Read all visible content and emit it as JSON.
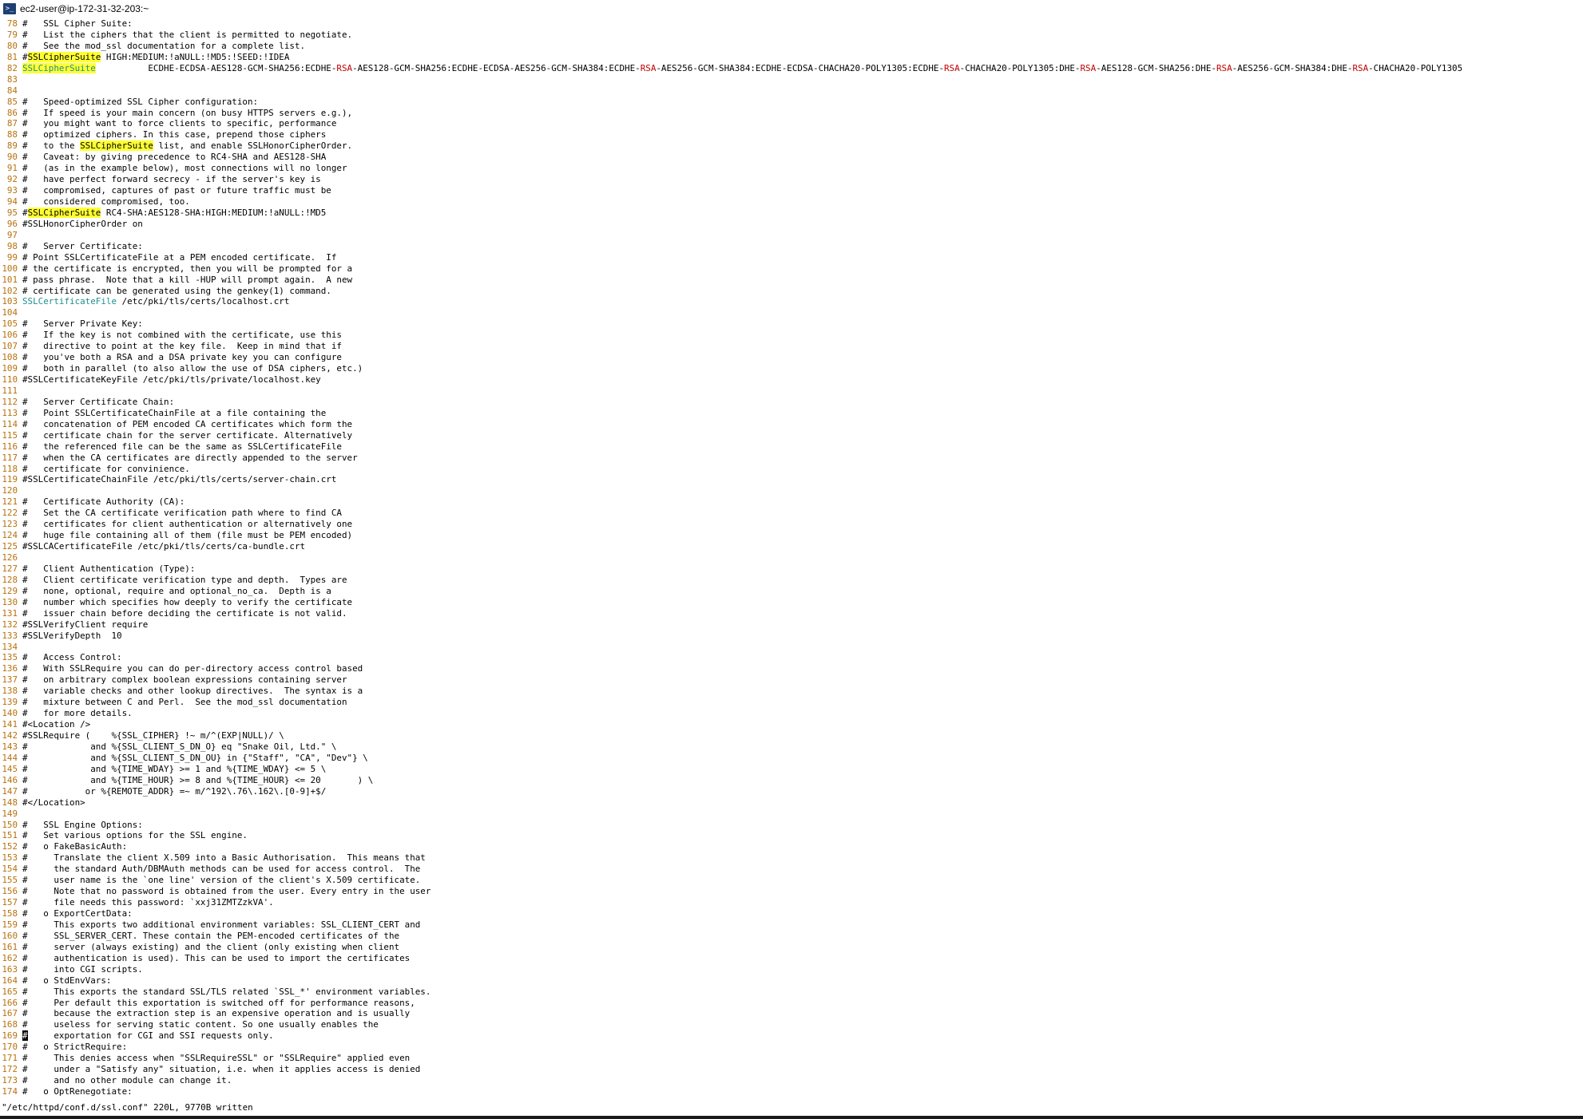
{
  "window": {
    "title": "ec2-user@ip-172-31-32-203:~",
    "icon": "terminal-icon"
  },
  "editor": {
    "lines": [
      {
        "n": "78",
        "t": "#   SSL Cipher Suite:"
      },
      {
        "n": "79",
        "t": "#   List the ciphers that the client is permitted to negotiate."
      },
      {
        "n": "80",
        "t": "#   See the mod_ssl documentation for a complete list."
      },
      {
        "n": "81",
        "t": "#SSLCipherSuite HIGH:MEDIUM:!aNULL:!MD5:!SEED:!IDEA"
      },
      {
        "n": "82",
        "t": "SSLCipherSuite          ECDHE-ECDSA-AES128-GCM-SHA256:ECDHE-RSA-AES128-GCM-SHA256:ECDHE-ECDSA-AES256-GCM-SHA384:ECDHE-RSA-AES256-GCM-SHA384:ECDHE-ECDSA-CHACHA20-POLY1305:ECDHE-RSA-CHACHA20-POLY1305:DHE-RSA-AES128-GCM-SHA256:DHE-RSA-AES256-GCM-SHA384:DHE-RSA-CHACHA20-POLY1305"
      },
      {
        "n": "83",
        "t": ""
      },
      {
        "n": "84",
        "t": ""
      },
      {
        "n": "85",
        "t": "#   Speed-optimized SSL Cipher configuration:"
      },
      {
        "n": "86",
        "t": "#   If speed is your main concern (on busy HTTPS servers e.g.),"
      },
      {
        "n": "87",
        "t": "#   you might want to force clients to specific, performance"
      },
      {
        "n": "88",
        "t": "#   optimized ciphers. In this case, prepend those ciphers"
      },
      {
        "n": "89",
        "t": "#   to the SSLCipherSuite list, and enable SSLHonorCipherOrder."
      },
      {
        "n": "90",
        "t": "#   Caveat: by giving precedence to RC4-SHA and AES128-SHA"
      },
      {
        "n": "91",
        "t": "#   (as in the example below), most connections will no longer"
      },
      {
        "n": "92",
        "t": "#   have perfect forward secrecy - if the server's key is"
      },
      {
        "n": "93",
        "t": "#   compromised, captures of past or future traffic must be"
      },
      {
        "n": "94",
        "t": "#   considered compromised, too."
      },
      {
        "n": "95",
        "t": "#SSLCipherSuite RC4-SHA:AES128-SHA:HIGH:MEDIUM:!aNULL:!MD5"
      },
      {
        "n": "96",
        "t": "#SSLHonorCipherOrder on"
      },
      {
        "n": "97",
        "t": ""
      },
      {
        "n": "98",
        "t": "#   Server Certificate:"
      },
      {
        "n": "99",
        "t": "# Point SSLCertificateFile at a PEM encoded certificate.  If"
      },
      {
        "n": "100",
        "t": "# the certificate is encrypted, then you will be prompted for a"
      },
      {
        "n": "101",
        "t": "# pass phrase.  Note that a kill -HUP will prompt again.  A new"
      },
      {
        "n": "102",
        "t": "# certificate can be generated using the genkey(1) command."
      },
      {
        "n": "103",
        "t": "SSLCertificateFile /etc/pki/tls/certs/localhost.crt"
      },
      {
        "n": "104",
        "t": ""
      },
      {
        "n": "105",
        "t": "#   Server Private Key:"
      },
      {
        "n": "106",
        "t": "#   If the key is not combined with the certificate, use this"
      },
      {
        "n": "107",
        "t": "#   directive to point at the key file.  Keep in mind that if"
      },
      {
        "n": "108",
        "t": "#   you've both a RSA and a DSA private key you can configure"
      },
      {
        "n": "109",
        "t": "#   both in parallel (to also allow the use of DSA ciphers, etc.)"
      },
      {
        "n": "110",
        "t": "#SSLCertificateKeyFile /etc/pki/tls/private/localhost.key"
      },
      {
        "n": "111",
        "t": ""
      },
      {
        "n": "112",
        "t": "#   Server Certificate Chain:"
      },
      {
        "n": "113",
        "t": "#   Point SSLCertificateChainFile at a file containing the"
      },
      {
        "n": "114",
        "t": "#   concatenation of PEM encoded CA certificates which form the"
      },
      {
        "n": "115",
        "t": "#   certificate chain for the server certificate. Alternatively"
      },
      {
        "n": "116",
        "t": "#   the referenced file can be the same as SSLCertificateFile"
      },
      {
        "n": "117",
        "t": "#   when the CA certificates are directly appended to the server"
      },
      {
        "n": "118",
        "t": "#   certificate for convinience."
      },
      {
        "n": "119",
        "t": "#SSLCertificateChainFile /etc/pki/tls/certs/server-chain.crt"
      },
      {
        "n": "120",
        "t": ""
      },
      {
        "n": "121",
        "t": "#   Certificate Authority (CA):"
      },
      {
        "n": "122",
        "t": "#   Set the CA certificate verification path where to find CA"
      },
      {
        "n": "123",
        "t": "#   certificates for client authentication or alternatively one"
      },
      {
        "n": "124",
        "t": "#   huge file containing all of them (file must be PEM encoded)"
      },
      {
        "n": "125",
        "t": "#SSLCACertificateFile /etc/pki/tls/certs/ca-bundle.crt"
      },
      {
        "n": "126",
        "t": ""
      },
      {
        "n": "127",
        "t": "#   Client Authentication (Type):"
      },
      {
        "n": "128",
        "t": "#   Client certificate verification type and depth.  Types are"
      },
      {
        "n": "129",
        "t": "#   none, optional, require and optional_no_ca.  Depth is a"
      },
      {
        "n": "130",
        "t": "#   number which specifies how deeply to verify the certificate"
      },
      {
        "n": "131",
        "t": "#   issuer chain before deciding the certificate is not valid."
      },
      {
        "n": "132",
        "t": "#SSLVerifyClient require"
      },
      {
        "n": "133",
        "t": "#SSLVerifyDepth  10"
      },
      {
        "n": "134",
        "t": ""
      },
      {
        "n": "135",
        "t": "#   Access Control:"
      },
      {
        "n": "136",
        "t": "#   With SSLRequire you can do per-directory access control based"
      },
      {
        "n": "137",
        "t": "#   on arbitrary complex boolean expressions containing server"
      },
      {
        "n": "138",
        "t": "#   variable checks and other lookup directives.  The syntax is a"
      },
      {
        "n": "139",
        "t": "#   mixture between C and Perl.  See the mod_ssl documentation"
      },
      {
        "n": "140",
        "t": "#   for more details."
      },
      {
        "n": "141",
        "t": "#<Location />"
      },
      {
        "n": "142",
        "t": "#SSLRequire (    %{SSL_CIPHER} !~ m/^(EXP|NULL)/ \\"
      },
      {
        "n": "143",
        "t": "#            and %{SSL_CLIENT_S_DN_O} eq \"Snake Oil, Ltd.\" \\"
      },
      {
        "n": "144",
        "t": "#            and %{SSL_CLIENT_S_DN_OU} in {\"Staff\", \"CA\", \"Dev\"} \\"
      },
      {
        "n": "145",
        "t": "#            and %{TIME_WDAY} >= 1 and %{TIME_WDAY} <= 5 \\"
      },
      {
        "n": "146",
        "t": "#            and %{TIME_HOUR} >= 8 and %{TIME_HOUR} <= 20       ) \\"
      },
      {
        "n": "147",
        "t": "#           or %{REMOTE_ADDR} =~ m/^192\\.76\\.162\\.[0-9]+$/"
      },
      {
        "n": "148",
        "t": "#</Location>"
      },
      {
        "n": "149",
        "t": ""
      },
      {
        "n": "150",
        "t": "#   SSL Engine Options:"
      },
      {
        "n": "151",
        "t": "#   Set various options for the SSL engine."
      },
      {
        "n": "152",
        "t": "#   o FakeBasicAuth:"
      },
      {
        "n": "153",
        "t": "#     Translate the client X.509 into a Basic Authorisation.  This means that"
      },
      {
        "n": "154",
        "t": "#     the standard Auth/DBMAuth methods can be used for access control.  The"
      },
      {
        "n": "155",
        "t": "#     user name is the `one line' version of the client's X.509 certificate."
      },
      {
        "n": "156",
        "t": "#     Note that no password is obtained from the user. Every entry in the user"
      },
      {
        "n": "157",
        "t": "#     file needs this password: `xxj31ZMTZzkVA'."
      },
      {
        "n": "158",
        "t": "#   o ExportCertData:"
      },
      {
        "n": "159",
        "t": "#     This exports two additional environment variables: SSL_CLIENT_CERT and"
      },
      {
        "n": "160",
        "t": "#     SSL_SERVER_CERT. These contain the PEM-encoded certificates of the"
      },
      {
        "n": "161",
        "t": "#     server (always existing) and the client (only existing when client"
      },
      {
        "n": "162",
        "t": "#     authentication is used). This can be used to import the certificates"
      },
      {
        "n": "163",
        "t": "#     into CGI scripts."
      },
      {
        "n": "164",
        "t": "#   o StdEnvVars:"
      },
      {
        "n": "165",
        "t": "#     This exports the standard SSL/TLS related `SSL_*' environment variables."
      },
      {
        "n": "166",
        "t": "#     Per default this exportation is switched off for performance reasons,"
      },
      {
        "n": "167",
        "t": "#     because the extraction step is an expensive operation and is usually"
      },
      {
        "n": "168",
        "t": "#     useless for serving static content. So one usually enables the"
      },
      {
        "n": "169",
        "t": "#     exportation for CGI and SSI requests only."
      },
      {
        "n": "170",
        "t": "#   o StrictRequire:"
      },
      {
        "n": "171",
        "t": "#     This denies access when \"SSLRequireSSL\" or \"SSLRequire\" applied even"
      },
      {
        "n": "172",
        "t": "#     under a \"Satisfy any\" situation, i.e. when it applies access is denied"
      },
      {
        "n": "173",
        "t": "#     and no other module can change it."
      },
      {
        "n": "174",
        "t": "#   o OptRenegotiate:"
      }
    ]
  },
  "status": {
    "message": "\"/etc/httpd/conf.d/ssl.conf\" 220L, 9770B written"
  },
  "colors": {
    "line_number": "#b8710d",
    "search_highlight": "#ffff33",
    "directive": "#1f8f8f",
    "rsa_token": "#c00000"
  }
}
